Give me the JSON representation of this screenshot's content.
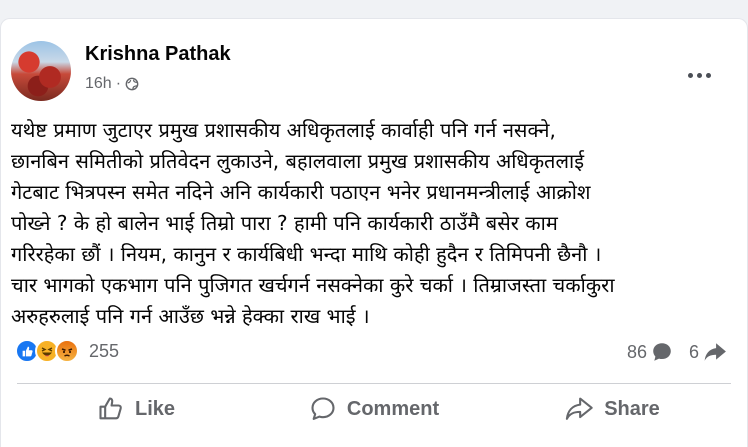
{
  "post": {
    "author": "Krishna Pathak",
    "time": "16h",
    "separator": "·",
    "text": "यथेष्ट प्रमाण जुटाएर प्रमुख प्रशासकीय अधिकृतलाई कार्वाही पनि गर्न नसक्ने,\nछानबिन समितीको प्रतिवेदन लुकाउने, बहालवाला प्रमुख प्रशासकीय अधिकृतलाई\nगेटबाट भित्रपस्न समेत नदिने अनि कार्यकारी पठाएन भनेर प्रधानमन्त्रीलाई आक्रोश\nपोख्ने ? के हो बालेन भाई तिम्रो पारा ? हामी पनि कार्यकारी ठाउँमै बसेर काम\nगरिरहेका छौं । नियम, कानुन र कार्यबिधी भन्दा माथि कोही हुदैन र तिमिपनी छैनौ ।\nचार भागको एकभाग पनि पुजिगत खर्चगर्न नसक्नेका कुरे चर्का । तिम्राजस्ता चर्काकुरा\nअरुहरुलाई पनि गर्न आउँछ भन्ने हेक्का राख भाई ।",
    "icons": {
      "audience": "globe-icon",
      "more": "more-options-icon"
    }
  },
  "engagement": {
    "reaction_count": "255",
    "reactions": [
      "like",
      "haha",
      "angry"
    ],
    "comment_count": "86",
    "share_count": "6"
  },
  "actions": {
    "like": "Like",
    "comment": "Comment",
    "share": "Share"
  },
  "colors": {
    "like_blue": "#1877f2",
    "haha_yellow": "#f7b125",
    "angry_orange": "#e9710f",
    "secondary_text": "#65676b"
  }
}
